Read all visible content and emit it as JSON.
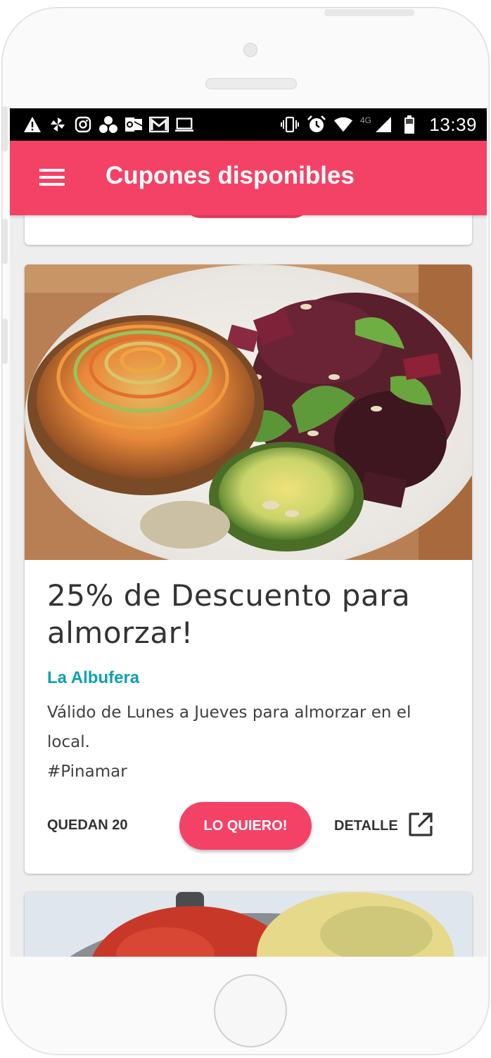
{
  "status_bar": {
    "time": "13:39",
    "network": "4G",
    "left_icons": [
      "alert-icon",
      "pinwheel-icon",
      "instagram-icon",
      "dots-cluster-icon",
      "outlook-icon",
      "gmail-icon",
      "laptop-icon"
    ],
    "right_icons": [
      "vibrate-icon",
      "alarm-icon",
      "wifi-icon",
      "signal-icon",
      "battery-icon"
    ]
  },
  "app_bar": {
    "title": "Cupones disponibles",
    "menu_icon": "hamburger-menu-icon",
    "color": "#f44267"
  },
  "coupon": {
    "title": "25% de Descuento para almorzar!",
    "venue": "La Albufera",
    "description_line1": "Válido de Lunes a Jueves para almorzar en el local.",
    "hashtag": "#Pinamar",
    "remaining": "QUEDAN 20",
    "cta_label": "LO QUIERO!",
    "detail_label": "DETALLE",
    "detail_icon": "open-in-new-icon",
    "venue_color": "#0fa0b2",
    "accent_color": "#f44267"
  }
}
